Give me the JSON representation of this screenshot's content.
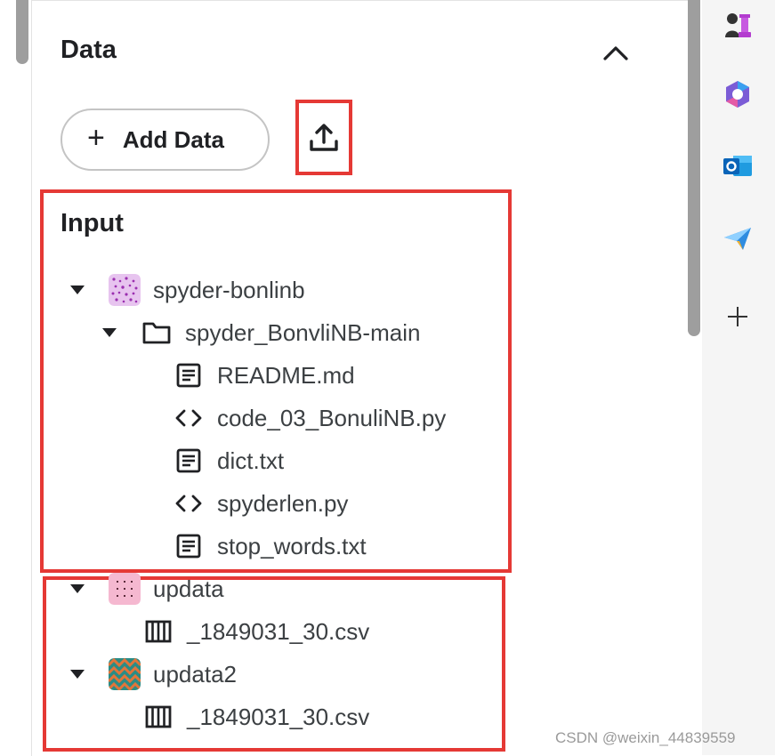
{
  "data_section": {
    "title": "Data",
    "add_data_label": "Add Data"
  },
  "input_section": {
    "title": "Input",
    "tree": [
      {
        "label": "spyder-bonlinb",
        "type": "dataset"
      },
      {
        "label": "spyder_BonvliNB-main",
        "type": "folder"
      },
      {
        "label": "README.md",
        "type": "text-file"
      },
      {
        "label": "code_03_BonuliNB.py",
        "type": "code-file"
      },
      {
        "label": "dict.txt",
        "type": "text-file"
      },
      {
        "label": "spyderlen.py",
        "type": "code-file"
      },
      {
        "label": "stop_words.txt",
        "type": "text-file"
      },
      {
        "label": "updata",
        "type": "dataset"
      },
      {
        "label": "_1849031_30.csv",
        "type": "table-file"
      },
      {
        "label": "updata2",
        "type": "dataset"
      },
      {
        "label": "_1849031_30.csv",
        "type": "table-file"
      }
    ]
  },
  "right_rail": {
    "icons": [
      "chess-icon",
      "copilot-icon",
      "outlook-icon",
      "send-icon",
      "plus-icon"
    ]
  },
  "watermark": "CSDN @weixin_44839559",
  "colors": {
    "highlight": "#e53935",
    "text": "#202124",
    "scrollbar": "#9e9e9e"
  }
}
